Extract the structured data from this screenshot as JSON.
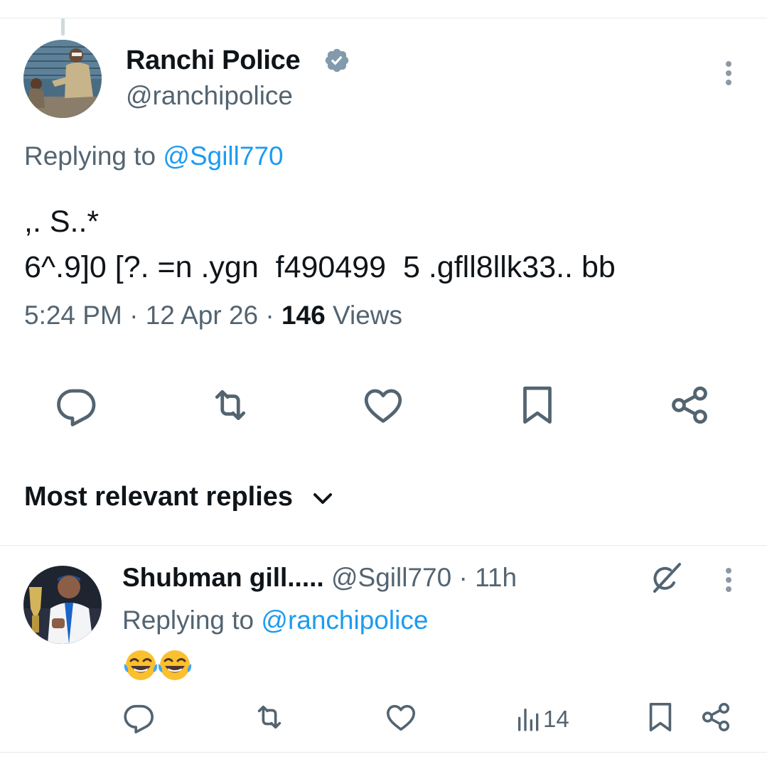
{
  "tweet": {
    "author_name": "Ranchi Police",
    "author_handle": "@ranchipolice",
    "replying_prefix": "Replying to ",
    "replying_to": "@Sgill770",
    "text_line1": ",. S..*",
    "text_line2": "6^.9]0 [?. =n .ygn  f490499  5 .gfll8llk33.. bb",
    "time": "5:24 PM",
    "date": "12 Apr 26",
    "separator": "·",
    "views_count": "146",
    "views_label": "Views"
  },
  "actions": {
    "icons": [
      "reply-icon",
      "retweet-icon",
      "like-icon",
      "bookmark-icon",
      "share-icon"
    ]
  },
  "replies_section": {
    "sort_label": "Most relevant replies"
  },
  "reply": {
    "author_name": "Shubman gill.....",
    "author_handle": "@Sgill770",
    "separator": "·",
    "age": "11h",
    "replying_prefix": "Replying to ",
    "replying_to": "@ranchipolice",
    "emoji": "😂😂",
    "views_count": "14"
  },
  "colors": {
    "text": "#0f1419",
    "muted": "#536471",
    "link": "#1d9bf0",
    "verified_badge": "#829aab",
    "divider": "#e7e9ea"
  }
}
